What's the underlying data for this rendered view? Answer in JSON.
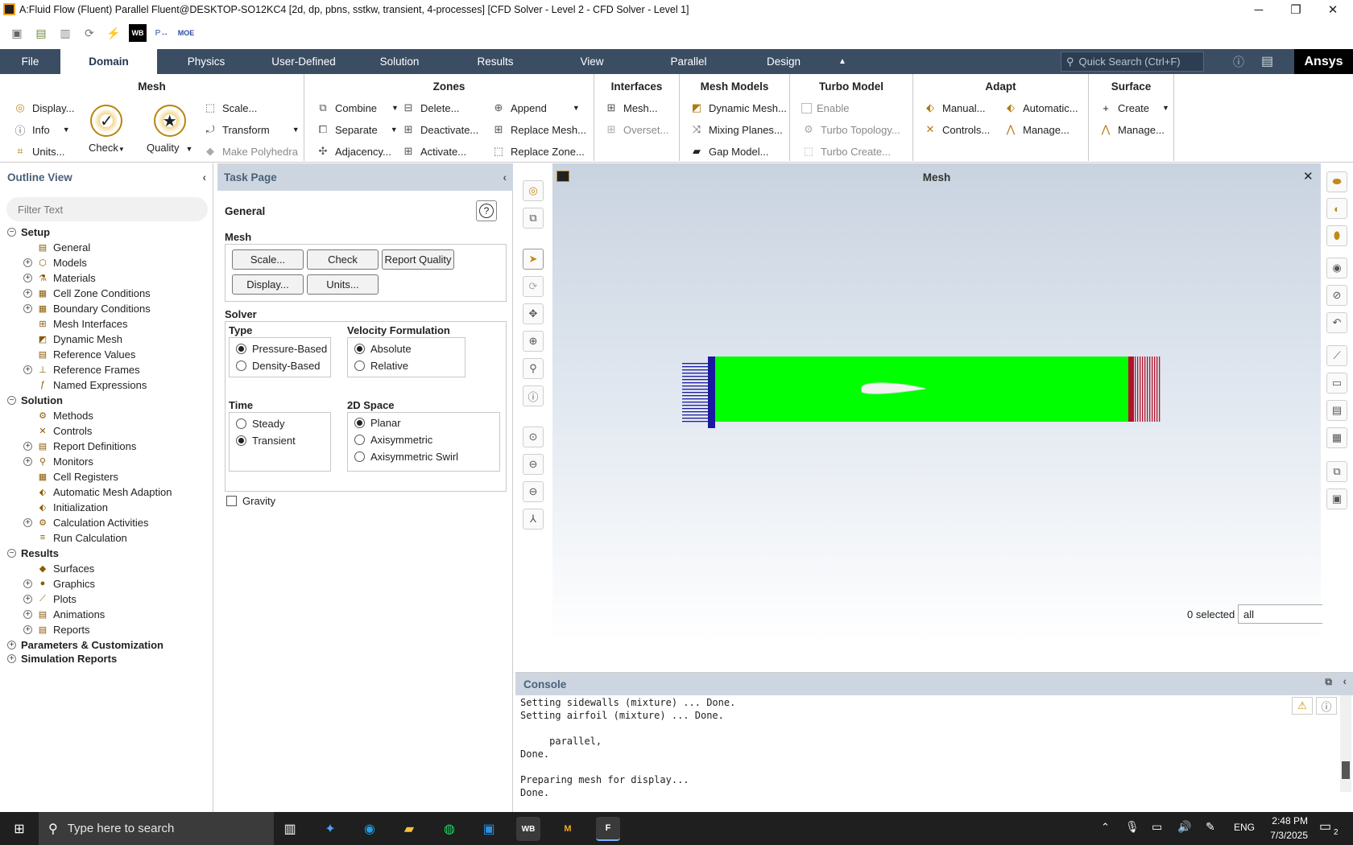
{
  "window": {
    "title": "A:Fluid Flow (Fluent) Parallel Fluent@DESKTOP-SO12KC4  [2d, dp, pbns, sstkw, transient, 4-processes] [CFD Solver - Level 2 - CFD Solver - Level 1]",
    "minimize": "─",
    "maximize": "❐",
    "close": "✕"
  },
  "ribbon_tabs": [
    "File",
    "Domain",
    "Physics",
    "User-Defined",
    "Solution",
    "Results",
    "View",
    "Parallel",
    "Design"
  ],
  "active_tab": "Domain",
  "quick_search": "Quick Search (Ctrl+F)",
  "brand": "Ansys",
  "ribbon": {
    "mesh": {
      "title": "Mesh",
      "display": "Display...",
      "info": "Info",
      "units": "Units...",
      "check": "Check",
      "quality": "Quality",
      "scale": "Scale...",
      "transform": "Transform",
      "make_polyhedra": "Make Polyhedra"
    },
    "zones": {
      "title": "Zones",
      "combine": "Combine",
      "separate": "Separate",
      "adjacency": "Adjacency...",
      "delete": "Delete...",
      "deactivate": "Deactivate...",
      "activate": "Activate...",
      "append": "Append",
      "replace_mesh": "Replace Mesh...",
      "replace_zone": "Replace Zone..."
    },
    "interfaces": {
      "title": "Interfaces",
      "mesh": "Mesh...",
      "overset": "Overset..."
    },
    "mesh_models": {
      "title": "Mesh Models",
      "dynamic": "Dynamic Mesh...",
      "mixing": "Mixing Planes...",
      "gap": "Gap Model..."
    },
    "turbo": {
      "title": "Turbo Model",
      "enable": "Enable",
      "topology": "Turbo Topology...",
      "create": "Turbo Create..."
    },
    "adapt": {
      "title": "Adapt",
      "manual": "Manual...",
      "controls": "Controls...",
      "automatic": "Automatic...",
      "manage": "Manage..."
    },
    "surface": {
      "title": "Surface",
      "create": "Create",
      "manage": "Manage..."
    }
  },
  "outline": {
    "title": "Outline View",
    "filter_placeholder": "Filter Text",
    "items": [
      {
        "label": "Setup",
        "level": 0,
        "bold": true,
        "exp": "−"
      },
      {
        "label": "General",
        "level": 1,
        "exp": ""
      },
      {
        "label": "Models",
        "level": 1,
        "exp": "+"
      },
      {
        "label": "Materials",
        "level": 1,
        "exp": "+"
      },
      {
        "label": "Cell Zone Conditions",
        "level": 1,
        "exp": "+"
      },
      {
        "label": "Boundary Conditions",
        "level": 1,
        "exp": "+"
      },
      {
        "label": "Mesh Interfaces",
        "level": 1,
        "exp": ""
      },
      {
        "label": "Dynamic Mesh",
        "level": 1,
        "exp": ""
      },
      {
        "label": "Reference Values",
        "level": 1,
        "exp": ""
      },
      {
        "label": "Reference Frames",
        "level": 1,
        "exp": "+"
      },
      {
        "label": "Named Expressions",
        "level": 1,
        "exp": ""
      },
      {
        "label": "Solution",
        "level": 0,
        "bold": true,
        "exp": "−"
      },
      {
        "label": "Methods",
        "level": 1,
        "exp": ""
      },
      {
        "label": "Controls",
        "level": 1,
        "exp": ""
      },
      {
        "label": "Report Definitions",
        "level": 1,
        "exp": "+"
      },
      {
        "label": "Monitors",
        "level": 1,
        "exp": "+"
      },
      {
        "label": "Cell Registers",
        "level": 1,
        "exp": ""
      },
      {
        "label": "Automatic Mesh Adaption",
        "level": 1,
        "exp": ""
      },
      {
        "label": "Initialization",
        "level": 1,
        "exp": ""
      },
      {
        "label": "Calculation Activities",
        "level": 1,
        "exp": "+"
      },
      {
        "label": "Run Calculation",
        "level": 1,
        "exp": ""
      },
      {
        "label": "Results",
        "level": 0,
        "bold": true,
        "exp": "−"
      },
      {
        "label": "Surfaces",
        "level": 1,
        "exp": ""
      },
      {
        "label": "Graphics",
        "level": 1,
        "exp": "+"
      },
      {
        "label": "Plots",
        "level": 1,
        "exp": "+"
      },
      {
        "label": "Animations",
        "level": 1,
        "exp": "+"
      },
      {
        "label": "Reports",
        "level": 1,
        "exp": "+"
      },
      {
        "label": "Parameters & Customization",
        "level": 0,
        "bold": true,
        "exp": "+"
      },
      {
        "label": "Simulation Reports",
        "level": 0,
        "bold": true,
        "exp": "+"
      }
    ]
  },
  "task_page": {
    "title": "Task Page",
    "section": "General",
    "mesh_label": "Mesh",
    "buttons": {
      "scale": "Scale...",
      "check": "Check",
      "report_quality": "Report Quality",
      "display": "Display...",
      "units": "Units..."
    },
    "solver_label": "Solver",
    "type_label": "Type",
    "type_options": [
      "Pressure-Based",
      "Density-Based"
    ],
    "type_selected": "Pressure-Based",
    "velocity_label": "Velocity Formulation",
    "velocity_options": [
      "Absolute",
      "Relative"
    ],
    "velocity_selected": "Absolute",
    "time_label": "Time",
    "time_options": [
      "Steady",
      "Transient"
    ],
    "time_selected": "Transient",
    "space_label": "2D Space",
    "space_options": [
      "Planar",
      "Axisymmetric",
      "Axisymmetric Swirl"
    ],
    "space_selected": "Planar",
    "gravity": "Gravity",
    "gravity_checked": false
  },
  "graphics": {
    "title": "Mesh",
    "selected_text": "0 selected",
    "selection_filter": "all",
    "colors": {
      "domain": "#00ff00",
      "inlet": "#1a1aa0",
      "outlet": "#b0122a"
    }
  },
  "console": {
    "title": "Console",
    "lines": [
      "Setting sidewalls (mixture) ... Done.",
      "Setting airfoil (mixture) ... Done.",
      "",
      "     parallel,",
      "Done.",
      "",
      "Preparing mesh for display...",
      "Done."
    ]
  },
  "taskbar": {
    "search_placeholder": "Type here to search",
    "apps": [
      "WB",
      "M",
      "F"
    ],
    "language": "ENG",
    "time": "2:48 PM",
    "date": "7/3/2025",
    "notifications": "2"
  }
}
